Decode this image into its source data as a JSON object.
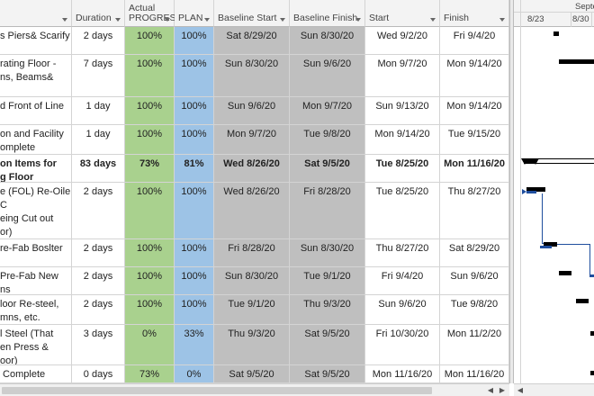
{
  "headers": {
    "name": "",
    "duration": "Duration",
    "actual": "Actual\nPROGRES",
    "plan": "PLAN",
    "baseline_start": "Baseline Start",
    "baseline_finish": "Baseline Finish",
    "start": "Start",
    "finish": "Finish"
  },
  "timescale": {
    "month_label": "Septe",
    "week_1": "8/23",
    "week_2": "8/30",
    "week_3": "9/"
  },
  "rows": [
    {
      "name": "s Piers& Scarify",
      "duration": "2 days",
      "actual": "100%",
      "plan": "100%",
      "baseline_start": "Sat 8/29/20",
      "baseline_finish": "Sun 8/30/20",
      "start": "Wed 9/2/20",
      "finish": "Fri 9/4/20",
      "bold": false
    },
    {
      "name": "rating Floor -\nns, Beams&",
      "duration": "7 days",
      "actual": "100%",
      "plan": "100%",
      "baseline_start": "Sun 8/30/20",
      "baseline_finish": "Sun 9/6/20",
      "start": "Mon 9/7/20",
      "finish": "Mon 9/14/20",
      "bold": false
    },
    {
      "name": "d Front of Line",
      "duration": "1 day",
      "actual": "100%",
      "plan": "100%",
      "baseline_start": "Sun 9/6/20",
      "baseline_finish": "Mon 9/7/20",
      "start": "Sun 9/13/20",
      "finish": "Mon 9/14/20",
      "bold": false
    },
    {
      "name": "on and Facility\nomplete",
      "duration": "1 day",
      "actual": "100%",
      "plan": "100%",
      "baseline_start": "Mon 9/7/20",
      "baseline_finish": "Tue 9/8/20",
      "start": "Mon 9/14/20",
      "finish": "Tue 9/15/20",
      "bold": false
    },
    {
      "name": "on Items for\ng Floor",
      "duration": "83 days",
      "actual": "73%",
      "plan": "81%",
      "baseline_start": "Wed 8/26/20",
      "baseline_finish": "Sat 9/5/20",
      "start": "Tue 8/25/20",
      "finish": "Mon 11/16/20",
      "bold": true
    },
    {
      "name": "e (FOL) Re-Oiler\nC\neing Cut out\nor)",
      "duration": "2 days",
      "actual": "100%",
      "plan": "100%",
      "baseline_start": "Wed 8/26/20",
      "baseline_finish": "Fri 8/28/20",
      "start": "Tue 8/25/20",
      "finish": "Thu 8/27/20",
      "bold": false
    },
    {
      "name": "re-Fab Boslter",
      "duration": "2 days",
      "actual": "100%",
      "plan": "100%",
      "baseline_start": "Fri 8/28/20",
      "baseline_finish": "Sun 8/30/20",
      "start": "Thu 8/27/20",
      "finish": "Sat 8/29/20",
      "bold": false
    },
    {
      "name": "Pre-Fab New\nns",
      "duration": "2 days",
      "actual": "100%",
      "plan": "100%",
      "baseline_start": "Sun 8/30/20",
      "baseline_finish": "Tue 9/1/20",
      "start": "Fri 9/4/20",
      "finish": "Sun 9/6/20",
      "bold": false
    },
    {
      "name": "loor Re-steel,\nmns, etc.",
      "duration": "2 days",
      "actual": "100%",
      "plan": "100%",
      "baseline_start": "Tue 9/1/20",
      "baseline_finish": "Thu 9/3/20",
      "start": "Sun 9/6/20",
      "finish": "Tue 9/8/20",
      "bold": false
    },
    {
      "name": "l Steel (That\nen Press &\noor)",
      "duration": "3 days",
      "actual": "0%",
      "plan": "33%",
      "baseline_start": "Thu 9/3/20",
      "baseline_finish": "Sat 9/5/20",
      "start": "Fri 10/30/20",
      "finish": "Mon 11/2/20",
      "bold": false
    },
    {
      "name": " Complete",
      "duration": "0 days",
      "actual": "73%",
      "plan": "0%",
      "baseline_start": "Sat 9/5/20",
      "baseline_finish": "Sat 9/5/20",
      "start": "Mon 11/16/20",
      "finish": "Mon 11/16/20",
      "bold": false
    }
  ],
  "colors": {
    "actual_column": "#a9d18e",
    "plan_column": "#9dc3e6",
    "baseline_columns": "#bfbfbf",
    "task_bar": "#000000",
    "progress_bar": "#1f4e9e"
  }
}
